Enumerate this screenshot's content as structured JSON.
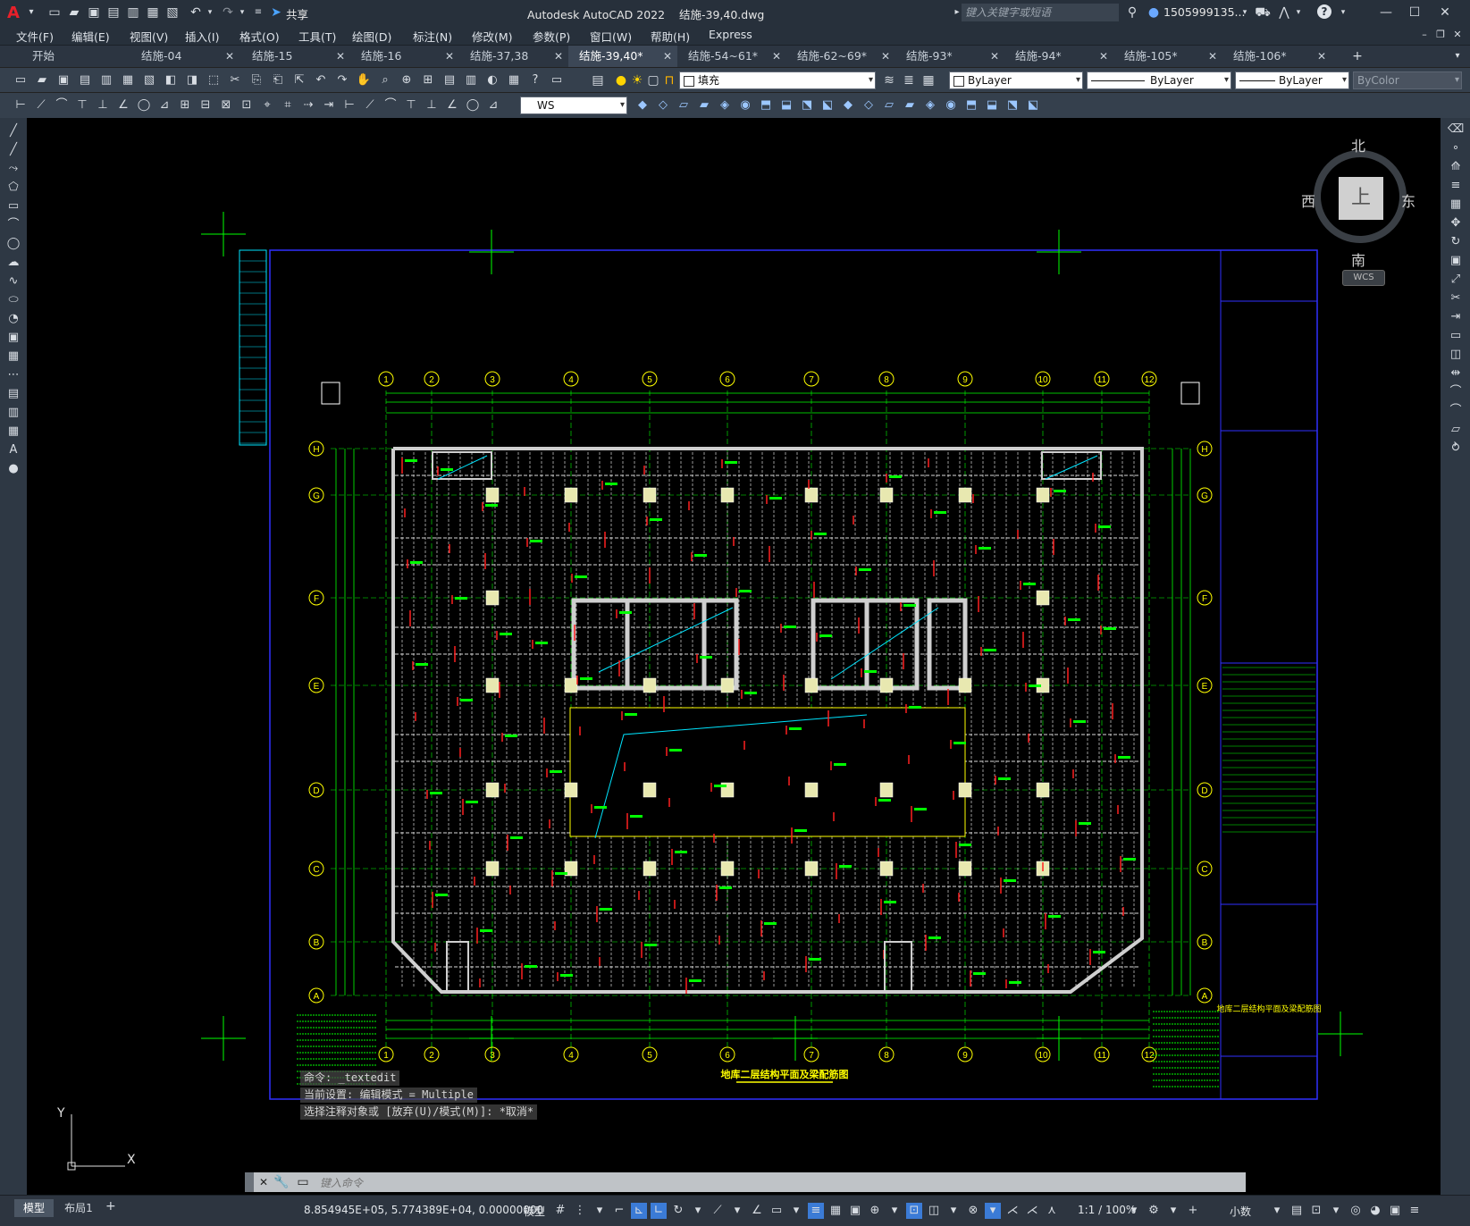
{
  "app": {
    "title": "Autodesk AutoCAD 2022",
    "file": "结施-39,40.dwg",
    "search_placeholder": "键入关键字或短语",
    "user": "1505999135...",
    "share": "共享"
  },
  "menu": [
    "文件(F)",
    "编辑(E)",
    "视图(V)",
    "插入(I)",
    "格式(O)",
    "工具(T)",
    "绘图(D)",
    "标注(N)",
    "修改(M)",
    "参数(P)",
    "窗口(W)",
    "帮助(H)",
    "Express"
  ],
  "tabs": [
    {
      "label": "开始",
      "active": false
    },
    {
      "label": "结施-04",
      "active": false
    },
    {
      "label": "结施-15",
      "active": false
    },
    {
      "label": "结施-16",
      "active": false
    },
    {
      "label": "结施-37,38",
      "active": false
    },
    {
      "label": "结施-39,40*",
      "active": true
    },
    {
      "label": "结施-54~61*",
      "active": false
    },
    {
      "label": "结施-62~69*",
      "active": false
    },
    {
      "label": "结施-93*",
      "active": false
    },
    {
      "label": "结施-94*",
      "active": false
    },
    {
      "label": "结施-105*",
      "active": false
    },
    {
      "label": "结施-106*",
      "active": false
    }
  ],
  "toolbar": {
    "layer": "填充",
    "color": "ByLayer",
    "linetype": "ByLayer",
    "lineweight": "ByLayer",
    "plotstyle": "ByColor",
    "ucs": "WS"
  },
  "viewcube": {
    "north": "北",
    "south": "南",
    "east": "东",
    "west": "西",
    "top": "上",
    "wcs": "WCS"
  },
  "drawing": {
    "grid_columns": [
      "1",
      "2",
      "3",
      "4",
      "5",
      "6",
      "7",
      "8",
      "9",
      "10",
      "11",
      "12"
    ],
    "grid_rows": [
      "H",
      "G",
      "F",
      "E",
      "D",
      "C",
      "B",
      "A"
    ],
    "title": "地库二层结构平面及梁配筋图",
    "axis_x": "X",
    "axis_y": "Y"
  },
  "command": {
    "history": [
      "命令: _textedit",
      "当前设置: 编辑模式 = Multiple",
      "选择注释对象或 [放弃(U)/模式(M)]: *取消*"
    ],
    "placeholder": "键入命令"
  },
  "status": {
    "coords": "8.854945E+05, 5.774389E+04, 0.00000000",
    "space": "模型",
    "layout_tabs": [
      "模型",
      "布局1"
    ],
    "scale": "1:1 / 100%",
    "units": "小数"
  },
  "colors": {
    "canvas": "#000000",
    "grid": "#00ff00",
    "frame": "#3030ff",
    "beam": "#cfcfcf",
    "column": "#e8e8b0",
    "rebar": "#ff2020",
    "cyan": "#00e5ff",
    "yellow": "#ffff00"
  }
}
